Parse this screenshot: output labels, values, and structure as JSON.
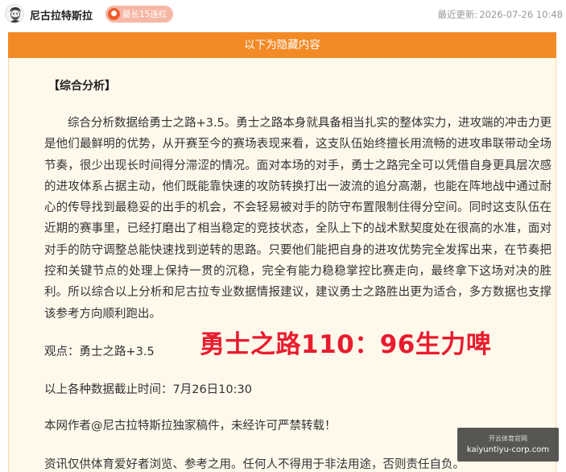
{
  "header": {
    "author_name": "尼古拉特斯拉",
    "badge_icon": "flame-icon",
    "badge_text": "最长15连红",
    "badge_color": "#f6b7a5",
    "updated_label": "最近更新:",
    "updated_time": "2026-07-26 10:48"
  },
  "hidden_banner": {
    "text": "以下为隐藏内容",
    "color": "#f28a25"
  },
  "article": {
    "section_title": "【综合分析】",
    "analysis": "综合分析数据给勇士之路+3.5。勇士之路本身就具备相当扎实的整体实力，进攻端的冲击力更是他们最鲜明的优势，从开赛至今的赛场表现来看，这支队伍始终擅长用流畅的进攻串联带动全场节奏，很少出现长时间得分滞涩的情况。面对本场的对手，勇士之路完全可以凭借自身更具层次感的进攻体系占据主动，他们既能靠快速的攻防转换打出一波流的追分高潮，也能在阵地战中通过耐心的传导找到最稳妥的出手的机会，不会轻易被对手的防守布置限制住得分空间。同时这支队伍在近期的赛事里，已经打磨出了相当稳定的竞技状态，全队上下的战术默契度处在很高的水准，面对对手的防守调整总能快速找到逆转的思路。只要他们能把自身的进攻优势完全发挥出来，在节奏把控和关键节点的处理上保持一贯的沉稳，完全有能力稳稳掌控比赛走向，最终拿下这场对决的胜利。所以综合以上分析和尼古拉专业数据情报建议，建议勇士之路胜出更为适合，多方数据也支撑该参考方向顺利跑出。",
    "viewpoint": "观点：勇士之路+3.5",
    "highlight_pick": "勇士之路110：96生力啤",
    "highlight_color": "#e81c2e",
    "data_cutoff": "以上各种数据截止时间：7月26日10:30",
    "copyright_notice": "本网作者@尼古拉特斯拉独家稿件，未经许可严禁转载！",
    "disclaimer": "资讯仅供体育爱好者浏览、参考之用。任何人不得用于非法用途，否则责任自负。"
  },
  "watermark": {
    "title": "开云体育官网",
    "url": "kaiyuntiyu-corp.com"
  }
}
